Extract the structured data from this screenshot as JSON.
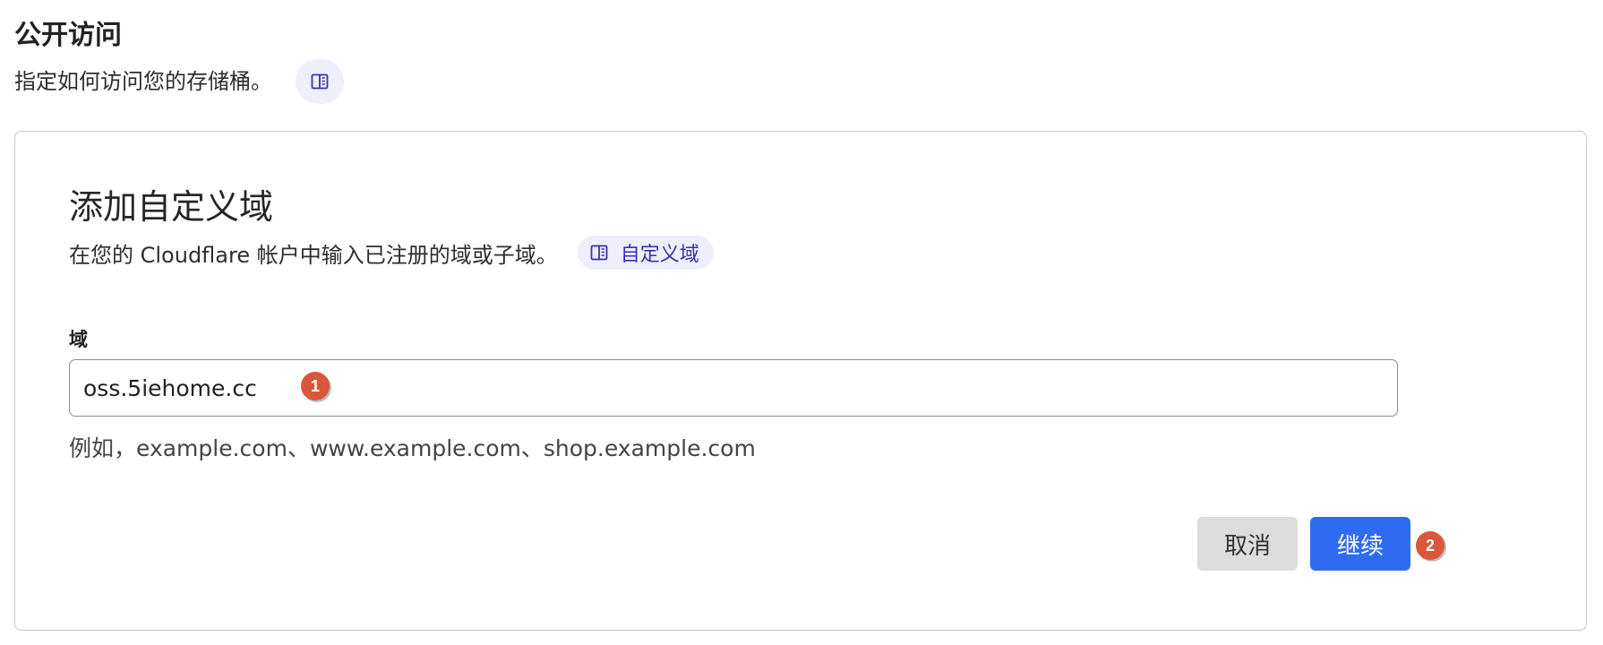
{
  "section": {
    "title": "公开访问",
    "description": "指定如何访问您的存储桶。",
    "doc_icon": "book-icon"
  },
  "card": {
    "title": "添加自定义域",
    "description": "在您的 Cloudflare 帐户中输入已注册的域或子域。",
    "doc_link_label": "自定义域",
    "doc_icon": "book-icon"
  },
  "domain_field": {
    "label": "域",
    "value": "oss.5iehome.cc",
    "hint": "例如，example.com、www.example.com、shop.example.com"
  },
  "actions": {
    "cancel_label": "取消",
    "continue_label": "继续"
  },
  "markers": {
    "first": "1",
    "second": "2"
  },
  "colors": {
    "accent": "#2f6bf0",
    "link": "#3a2fb0",
    "pill_bg": "#efeefb",
    "marker": "#d9573c"
  }
}
